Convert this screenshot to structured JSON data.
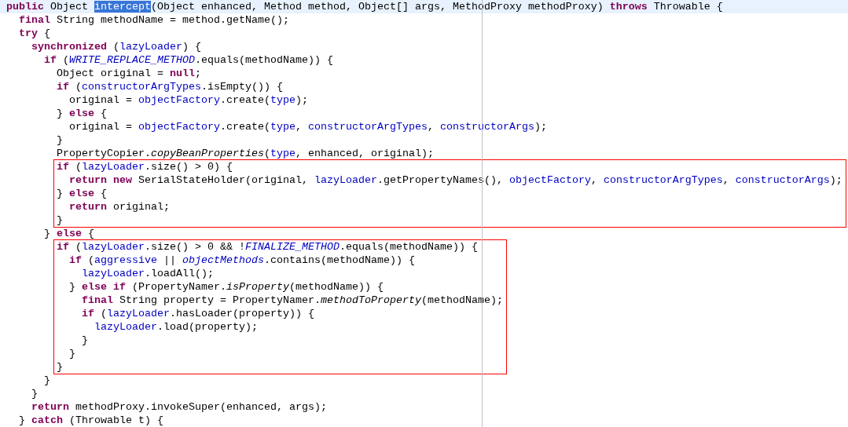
{
  "editor": {
    "blocks": [
      {
        "kind": "plain",
        "lines": [
          {
            "current": true,
            "tokens": [
              {
                "kind": "keyword",
                "text": "public"
              },
              {
                "kind": "plain",
                "text": " Object "
              },
              {
                "kind": "selection",
                "text": "intercept"
              },
              {
                "kind": "plain",
                "text": "(Object enhanced, Method method, Object[] args, MethodProxy methodProxy) "
              },
              {
                "kind": "keyword",
                "text": "throws"
              },
              {
                "kind": "plain",
                "text": " Throwable {"
              }
            ]
          },
          {
            "current": false,
            "tokens": [
              {
                "kind": "keyword",
                "text": "  final"
              },
              {
                "kind": "plain",
                "text": " String methodName = method.getName();"
              }
            ]
          },
          {
            "current": false,
            "tokens": [
              {
                "kind": "keyword",
                "text": "  try"
              },
              {
                "kind": "plain",
                "text": " {"
              }
            ]
          },
          {
            "current": false,
            "tokens": [
              {
                "kind": "keyword",
                "text": "    synchronized"
              },
              {
                "kind": "plain",
                "text": " ("
              },
              {
                "kind": "field",
                "text": "lazyLoader"
              },
              {
                "kind": "plain",
                "text": ") {"
              }
            ]
          },
          {
            "current": false,
            "tokens": [
              {
                "kind": "keyword",
                "text": "      if"
              },
              {
                "kind": "plain",
                "text": " ("
              },
              {
                "kind": "constant",
                "text": "WRITE_REPLACE_METHOD"
              },
              {
                "kind": "plain",
                "text": ".equals(methodName)) {"
              }
            ]
          },
          {
            "current": false,
            "tokens": [
              {
                "kind": "plain",
                "text": "        Object original = "
              },
              {
                "kind": "keyword",
                "text": "null"
              },
              {
                "kind": "plain",
                "text": ";"
              }
            ]
          },
          {
            "current": false,
            "tokens": [
              {
                "kind": "keyword",
                "text": "        if"
              },
              {
                "kind": "plain",
                "text": " ("
              },
              {
                "kind": "field",
                "text": "constructorArgTypes"
              },
              {
                "kind": "plain",
                "text": ".isEmpty()) {"
              }
            ]
          },
          {
            "current": false,
            "tokens": [
              {
                "kind": "plain",
                "text": "          original = "
              },
              {
                "kind": "field",
                "text": "objectFactory"
              },
              {
                "kind": "plain",
                "text": ".create("
              },
              {
                "kind": "field",
                "text": "type"
              },
              {
                "kind": "plain",
                "text": ");"
              }
            ]
          },
          {
            "current": false,
            "tokens": [
              {
                "kind": "plain",
                "text": "        } "
              },
              {
                "kind": "keyword",
                "text": "else"
              },
              {
                "kind": "plain",
                "text": " {"
              }
            ]
          },
          {
            "current": false,
            "tokens": [
              {
                "kind": "plain",
                "text": "          original = "
              },
              {
                "kind": "field",
                "text": "objectFactory"
              },
              {
                "kind": "plain",
                "text": ".create("
              },
              {
                "kind": "field",
                "text": "type"
              },
              {
                "kind": "plain",
                "text": ", "
              },
              {
                "kind": "field",
                "text": "constructorArgTypes"
              },
              {
                "kind": "plain",
                "text": ", "
              },
              {
                "kind": "field",
                "text": "constructorArgs"
              },
              {
                "kind": "plain",
                "text": ");"
              }
            ]
          },
          {
            "current": false,
            "tokens": [
              {
                "kind": "plain",
                "text": "        }"
              }
            ]
          },
          {
            "current": false,
            "tokens": [
              {
                "kind": "plain",
                "text": "        PropertyCopier."
              },
              {
                "kind": "static",
                "text": "copyBeanProperties"
              },
              {
                "kind": "plain",
                "text": "("
              },
              {
                "kind": "field",
                "text": "type"
              },
              {
                "kind": "plain",
                "text": ", enhanced, original);"
              }
            ]
          }
        ]
      },
      {
        "kind": "boxed",
        "lines": [
          {
            "current": false,
            "tokens": [
              {
                "kind": "keyword",
                "text": "        if"
              },
              {
                "kind": "plain",
                "text": " ("
              },
              {
                "kind": "field",
                "text": "lazyLoader"
              },
              {
                "kind": "plain",
                "text": ".size() > 0) {"
              }
            ]
          },
          {
            "current": false,
            "tokens": [
              {
                "kind": "keyword",
                "text": "          return"
              },
              {
                "kind": "keyword",
                "text": " new"
              },
              {
                "kind": "plain",
                "text": " SerialStateHolder(original, "
              },
              {
                "kind": "field",
                "text": "lazyLoader"
              },
              {
                "kind": "plain",
                "text": ".getPropertyNames(), "
              },
              {
                "kind": "field",
                "text": "objectFactory"
              },
              {
                "kind": "plain",
                "text": ", "
              },
              {
                "kind": "field",
                "text": "constructorArgTypes"
              },
              {
                "kind": "plain",
                "text": ", "
              },
              {
                "kind": "field",
                "text": "constructorArgs"
              },
              {
                "kind": "plain",
                "text": ");"
              }
            ]
          },
          {
            "current": false,
            "tokens": [
              {
                "kind": "plain",
                "text": "        } "
              },
              {
                "kind": "keyword",
                "text": "else"
              },
              {
                "kind": "plain",
                "text": " {"
              }
            ]
          },
          {
            "current": false,
            "tokens": [
              {
                "kind": "keyword",
                "text": "          return"
              },
              {
                "kind": "plain",
                "text": " original;"
              }
            ]
          },
          {
            "current": false,
            "tokens": [
              {
                "kind": "plain",
                "text": "        }"
              }
            ]
          }
        ]
      },
      {
        "kind": "plain",
        "lines": [
          {
            "current": false,
            "tokens": [
              {
                "kind": "plain",
                "text": "      } "
              },
              {
                "kind": "keyword",
                "text": "else"
              },
              {
                "kind": "plain",
                "text": " {"
              }
            ]
          }
        ]
      },
      {
        "kind": "boxed",
        "lines": [
          {
            "current": false,
            "tokens": [
              {
                "kind": "keyword",
                "text": "        if"
              },
              {
                "kind": "plain",
                "text": " ("
              },
              {
                "kind": "field",
                "text": "lazyLoader"
              },
              {
                "kind": "plain",
                "text": ".size() > 0 && !"
              },
              {
                "kind": "constant",
                "text": "FINALIZE_METHOD"
              },
              {
                "kind": "plain",
                "text": ".equals(methodName)) {"
              }
            ]
          },
          {
            "current": false,
            "tokens": [
              {
                "kind": "keyword",
                "text": "          if"
              },
              {
                "kind": "plain",
                "text": " ("
              },
              {
                "kind": "field",
                "text": "aggressive"
              },
              {
                "kind": "plain",
                "text": " || "
              },
              {
                "kind": "constant",
                "text": "objectMethods"
              },
              {
                "kind": "plain",
                "text": ".contains(methodName)) {"
              }
            ]
          },
          {
            "current": false,
            "tokens": [
              {
                "kind": "field",
                "text": "            lazyLoader"
              },
              {
                "kind": "plain",
                "text": ".loadAll();"
              }
            ]
          },
          {
            "current": false,
            "tokens": [
              {
                "kind": "plain",
                "text": "          } "
              },
              {
                "kind": "keyword",
                "text": "else"
              },
              {
                "kind": "keyword",
                "text": " if"
              },
              {
                "kind": "plain",
                "text": " (PropertyNamer."
              },
              {
                "kind": "static",
                "text": "isProperty"
              },
              {
                "kind": "plain",
                "text": "(methodName)) {"
              }
            ]
          },
          {
            "current": false,
            "tokens": [
              {
                "kind": "keyword",
                "text": "            final"
              },
              {
                "kind": "plain",
                "text": " String property = PropertyNamer."
              },
              {
                "kind": "static",
                "text": "methodToProperty"
              },
              {
                "kind": "plain",
                "text": "(methodName);"
              }
            ]
          },
          {
            "current": false,
            "tokens": [
              {
                "kind": "keyword",
                "text": "            if"
              },
              {
                "kind": "plain",
                "text": " ("
              },
              {
                "kind": "field",
                "text": "lazyLoader"
              },
              {
                "kind": "plain",
                "text": ".hasLoader(property)) {"
              }
            ]
          },
          {
            "current": false,
            "tokens": [
              {
                "kind": "field",
                "text": "              lazyLoader"
              },
              {
                "kind": "plain",
                "text": ".load(property);"
              }
            ]
          },
          {
            "current": false,
            "tokens": [
              {
                "kind": "plain",
                "text": "            }"
              }
            ]
          },
          {
            "current": false,
            "tokens": [
              {
                "kind": "plain",
                "text": "          }"
              }
            ]
          },
          {
            "current": false,
            "tokens": [
              {
                "kind": "plain",
                "text": "        }"
              }
            ]
          }
        ]
      },
      {
        "kind": "plain",
        "lines": [
          {
            "current": false,
            "tokens": [
              {
                "kind": "plain",
                "text": "      }"
              }
            ]
          },
          {
            "current": false,
            "tokens": [
              {
                "kind": "plain",
                "text": "    }"
              }
            ]
          },
          {
            "current": false,
            "tokens": [
              {
                "kind": "keyword",
                "text": "    return"
              },
              {
                "kind": "plain",
                "text": " methodProxy.invokeSuper(enhanced, args);"
              }
            ]
          },
          {
            "current": false,
            "tokens": [
              {
                "kind": "plain",
                "text": "  } "
              },
              {
                "kind": "keyword",
                "text": "catch"
              },
              {
                "kind": "plain",
                "text": " (Throwable t) {"
              }
            ]
          }
        ]
      }
    ]
  }
}
